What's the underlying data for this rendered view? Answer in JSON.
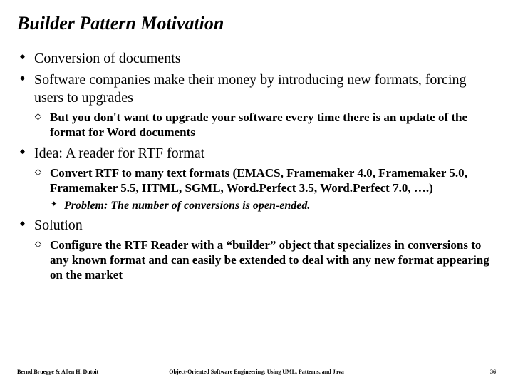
{
  "title": "Builder Pattern Motivation",
  "bullets": {
    "b1": "Conversion of documents",
    "b2": "Software companies make their money by introducing new formats, forcing users to upgrades",
    "b2_1": "But you don't want to upgrade your software every time there is an update of the format for Word documents",
    "b3": "Idea: A reader for RTF format",
    "b3_1": "Convert RTF to many text formats (EMACS, Framemaker 4.0, Framemaker 5.0, Framemaker 5.5, HTML, SGML, Word.Perfect 3.5, Word.Perfect 7.0, ….)",
    "b3_1_1": "Problem: The number of conversions is open-ended.",
    "b4": "Solution",
    "b4_1": "Configure the RTF Reader with a “builder” object that specializes in conversions to any known format and can easily be extended to deal with any new format appearing on the market"
  },
  "footer": {
    "left": "Bernd Bruegge & Allen H. Dutoit",
    "center": "Object-Oriented Software Engineering: Using UML, Patterns, and Java",
    "right": "36"
  }
}
